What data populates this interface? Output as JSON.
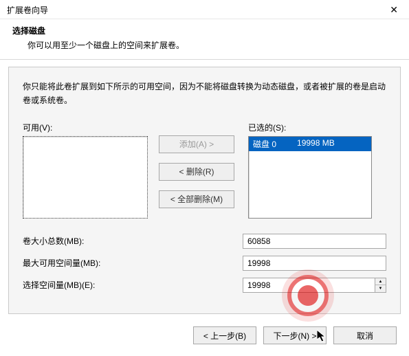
{
  "window": {
    "title": "扩展卷向导",
    "close": "✕"
  },
  "header": {
    "title": "选择磁盘",
    "subtitle": "你可以用至少一个磁盘上的空间来扩展卷。"
  },
  "panel": {
    "description": "你只能将此卷扩展到如下所示的可用空间，因为不能将磁盘转换为动态磁盘，或者被扩展的卷是启动卷或系统卷。",
    "available_label": "可用(V):",
    "selected_label": "已选的(S):",
    "buttons": {
      "add": "添加(A)  >",
      "remove": "<  删除(R)",
      "remove_all": "<  全部删除(M)"
    },
    "selected_items": [
      {
        "disk": "磁盘 0",
        "size": "19998 MB"
      }
    ],
    "fields": {
      "total_label": "卷大小总数(MB):",
      "total_value": "60858",
      "max_label": "最大可用空间量(MB):",
      "max_value": "19998",
      "select_label": "选择空间量(MB)(E):",
      "select_value": "19998"
    }
  },
  "footer": {
    "back": "< 上一步(B)",
    "next": "下一步(N) >",
    "cancel": "取消"
  }
}
